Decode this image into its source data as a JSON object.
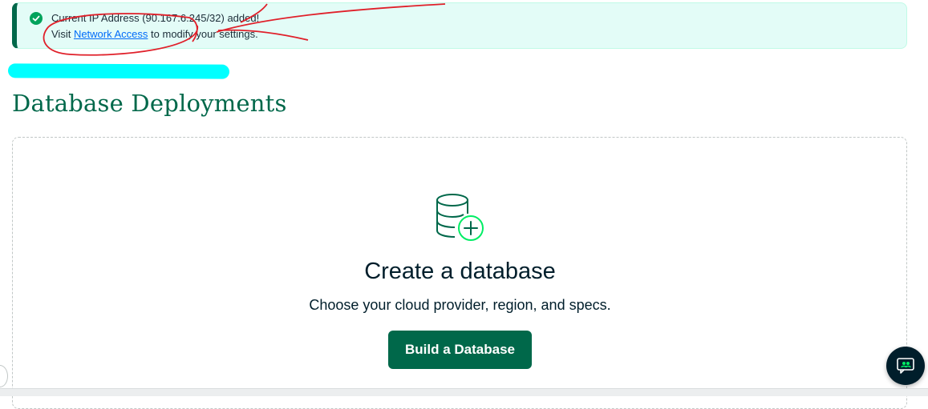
{
  "alert": {
    "message": "Current IP Address (90.167.6.245/32) added!",
    "visit_prefix": "Visit ",
    "link_text": "Network Access",
    "visit_suffix": " to modify your settings.",
    "icon": "check-circle-icon",
    "accent_color": "#00684a"
  },
  "page": {
    "title": "Database Deployments"
  },
  "empty_state": {
    "icon": "database-add-icon",
    "title": "Create a database",
    "subtitle": "Choose your cloud provider, region, and specs.",
    "button_label": "Build a Database"
  },
  "chat": {
    "icon": "chat-support-icon"
  },
  "colors": {
    "brand_green": "#00684a",
    "alert_bg": "#e3fcf7",
    "annotation_red": "#e0202a",
    "annotation_cyan": "#00ffff"
  }
}
